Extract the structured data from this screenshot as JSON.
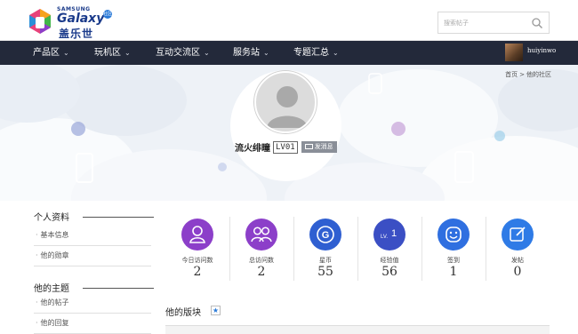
{
  "header": {
    "logo_brand": "SAMSUNG",
    "logo_product": "Galaxy",
    "logo_cn": "盖乐世",
    "logo_badge": "社区",
    "search_placeholder": "搜索帖子",
    "search_icon": "search-icon"
  },
  "nav": {
    "items": [
      {
        "label": "产品区"
      },
      {
        "label": "玩机区"
      },
      {
        "label": "互动交流区"
      },
      {
        "label": "服务站"
      },
      {
        "label": "专题汇总"
      }
    ],
    "username": "huiyinwo"
  },
  "breadcrumb": {
    "home": "首页",
    "sep": ">",
    "current": "他的社区"
  },
  "profile": {
    "name": "流火绯瞳",
    "level": "LV01",
    "message_button": "发消息"
  },
  "sidebar": {
    "personal_title": "个人资料",
    "personal_links": [
      "基本信息",
      "他的勋章"
    ],
    "topics_title": "他的主题",
    "topics_links": [
      "他的帖子",
      "他的回复"
    ]
  },
  "stats": [
    {
      "label": "今日访问数",
      "value": "2",
      "icon": "person-icon",
      "color": "#8c3fc9"
    },
    {
      "label": "总访问数",
      "value": "2",
      "icon": "group-icon",
      "color": "#8c3fc9"
    },
    {
      "label": "星币",
      "value": "55",
      "icon": "coin-icon",
      "color": "#2f5fd1"
    },
    {
      "label": "经验值",
      "value": "56",
      "icon": "level-icon",
      "color": "#3b4fc4"
    },
    {
      "label": "签到",
      "value": "1",
      "icon": "smile-icon",
      "color": "#2f6fe0"
    },
    {
      "label": "发帖",
      "value": "0",
      "icon": "edit-icon",
      "color": "#2f7be6"
    }
  ],
  "stat_icon_text": {
    "coin": "G",
    "level_prefix": "LV.",
    "level_num": "1"
  },
  "boards": {
    "title": "他的版块",
    "star": "★"
  },
  "colors": {
    "nav_bg": "#23293a",
    "accent": "#2a7ad8"
  }
}
